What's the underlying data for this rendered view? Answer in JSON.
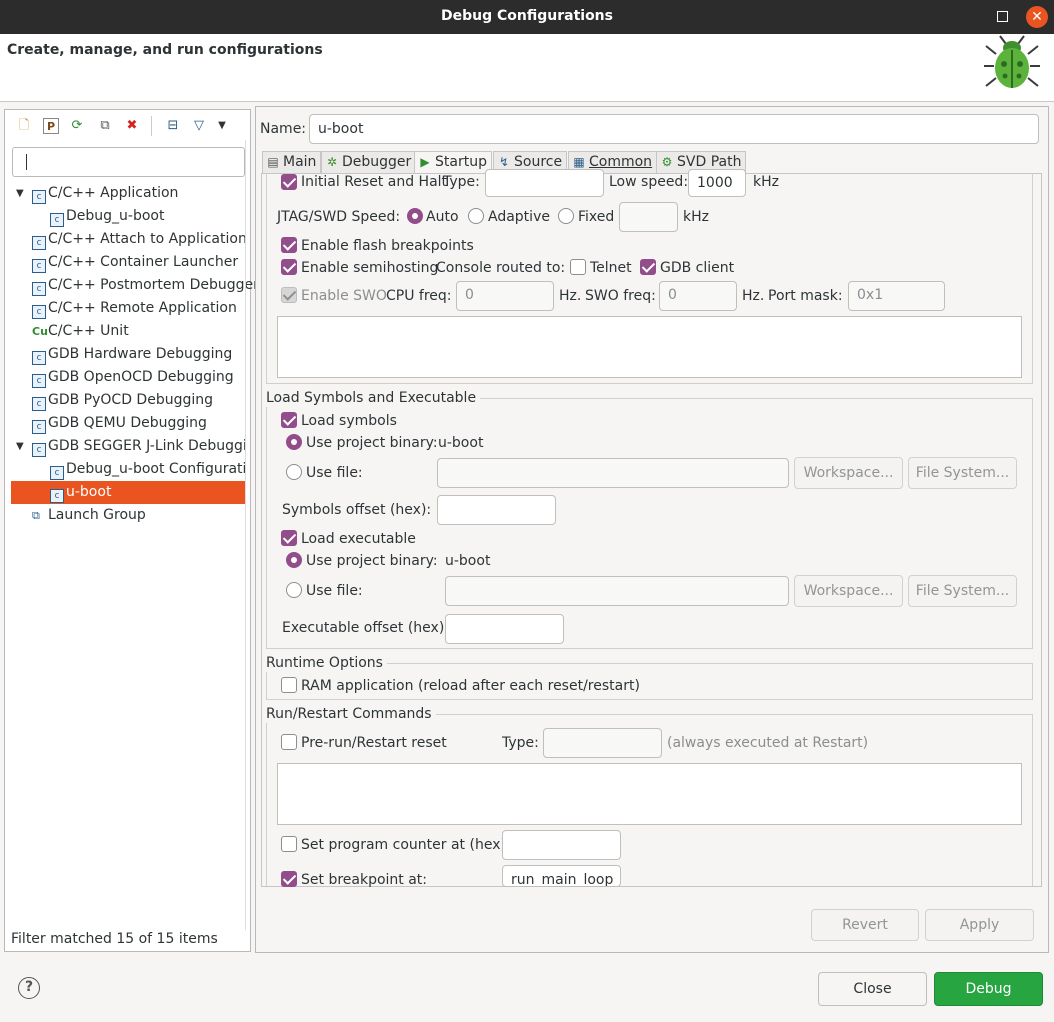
{
  "window": {
    "title": "Debug Configurations"
  },
  "header": {
    "text": "Create, manage, and run configurations"
  },
  "toolbar": {
    "icons": [
      "new-configuration-icon",
      "new-prototype-icon",
      "export-icon",
      "duplicate-icon",
      "delete-icon",
      "collapse-all-icon",
      "filter-icon",
      "view-menu-icon"
    ]
  },
  "tree": {
    "filter_value": "",
    "items": [
      {
        "label": "C/C++ Application",
        "expanded": true
      },
      {
        "label": "Debug_u-boot"
      },
      {
        "label": "C/C++ Attach to Application"
      },
      {
        "label": "C/C++ Container Launcher"
      },
      {
        "label": "C/C++ Postmortem Debugger"
      },
      {
        "label": "C/C++ Remote Application"
      },
      {
        "label": "C/C++ Unit"
      },
      {
        "label": "GDB Hardware Debugging"
      },
      {
        "label": "GDB OpenOCD Debugging"
      },
      {
        "label": "GDB PyOCD Debugging"
      },
      {
        "label": "GDB QEMU Debugging"
      },
      {
        "label": "GDB SEGGER J-Link Debugging",
        "expanded": true
      },
      {
        "label": "Debug_u-boot Configuration"
      },
      {
        "label": "u-boot",
        "selected": true
      },
      {
        "label": "Launch Group"
      }
    ],
    "status": "Filter matched 15 of 15 items"
  },
  "config": {
    "name_label": "Name:",
    "name_value": "u-boot",
    "tabs": [
      {
        "label": "Main",
        "icon": "main-tab-icon"
      },
      {
        "label": "Debugger",
        "icon": "debugger-tab-icon"
      },
      {
        "label": "Startup",
        "icon": "startup-tab-icon",
        "active": true
      },
      {
        "label": "Source",
        "icon": "source-tab-icon"
      },
      {
        "label": "Common",
        "icon": "common-tab-icon"
      },
      {
        "label": "SVD Path",
        "icon": "svd-path-tab-icon"
      }
    ]
  },
  "init": {
    "initial_reset_label": "Initial Reset and Halt",
    "initial_reset_checked": true,
    "type_label": "Type:",
    "type_value": "",
    "low_speed_label": "Low speed:",
    "low_speed_value": "1000",
    "low_speed_unit": "kHz",
    "jtag_speed_label": "JTAG/SWD Speed:",
    "speed_options": [
      "Auto",
      "Adaptive",
      "Fixed"
    ],
    "speed_selected": "Auto",
    "fixed_value": "",
    "fixed_unit": "kHz",
    "flash_bp_label": "Enable flash breakpoints",
    "semihosting_label": "Enable semihosting",
    "console_routed_label": "Console routed to:",
    "telnet_label": "Telnet",
    "gdb_client_label": "GDB client",
    "swo_label": "Enable SWO",
    "cpu_freq_label": "CPU freq:",
    "cpu_freq_value": "0",
    "hz1": "Hz.",
    "swo_freq_label": "SWO freq:",
    "swo_freq_value": "0",
    "hz2": "Hz.",
    "port_mask_label": "Port mask:",
    "port_mask_value": "0x1",
    "commands_text": ""
  },
  "load": {
    "group_title": "Load Symbols and Executable",
    "load_symbols_label": "Load symbols",
    "use_project_binary_label": "Use project binary:",
    "symbols_binary": "u-boot",
    "use_file_label": "Use file:",
    "symbols_file_value": "",
    "workspace_label": "Workspace...",
    "file_system_label": "File System...",
    "symbols_offset_label": "Symbols offset (hex):",
    "symbols_offset_value": "",
    "load_exec_label": "Load executable",
    "exec_project_binary_label": "Use project binary:",
    "exec_binary": "u-boot",
    "exec_use_file_label": "Use file:",
    "exec_file_value": "",
    "exec_workspace_label": "Workspace...",
    "exec_file_system_label": "File System...",
    "exec_offset_label": "Executable offset (hex):",
    "exec_offset_value": ""
  },
  "runtime": {
    "group_title": "Runtime Options",
    "ram_app_label": "RAM application (reload after each reset/restart)"
  },
  "run": {
    "group_title": "Run/Restart Commands",
    "prerun_label": "Pre-run/Restart reset",
    "type_label": "Type:",
    "type_value": "",
    "always_note": "(always executed at Restart)",
    "commands_text": "",
    "set_pc_label": "Set program counter at (hex):",
    "set_pc_value": "",
    "set_bp_label": "Set breakpoint at:",
    "set_bp_value": "run_main_loop"
  },
  "buttons": {
    "revert": "Revert",
    "apply": "Apply",
    "close": "Close",
    "debug": "Debug",
    "help": "?"
  },
  "colors": {
    "accent": "#e95420",
    "checkbox": "#924d8b",
    "debug_button": "#26a540"
  }
}
